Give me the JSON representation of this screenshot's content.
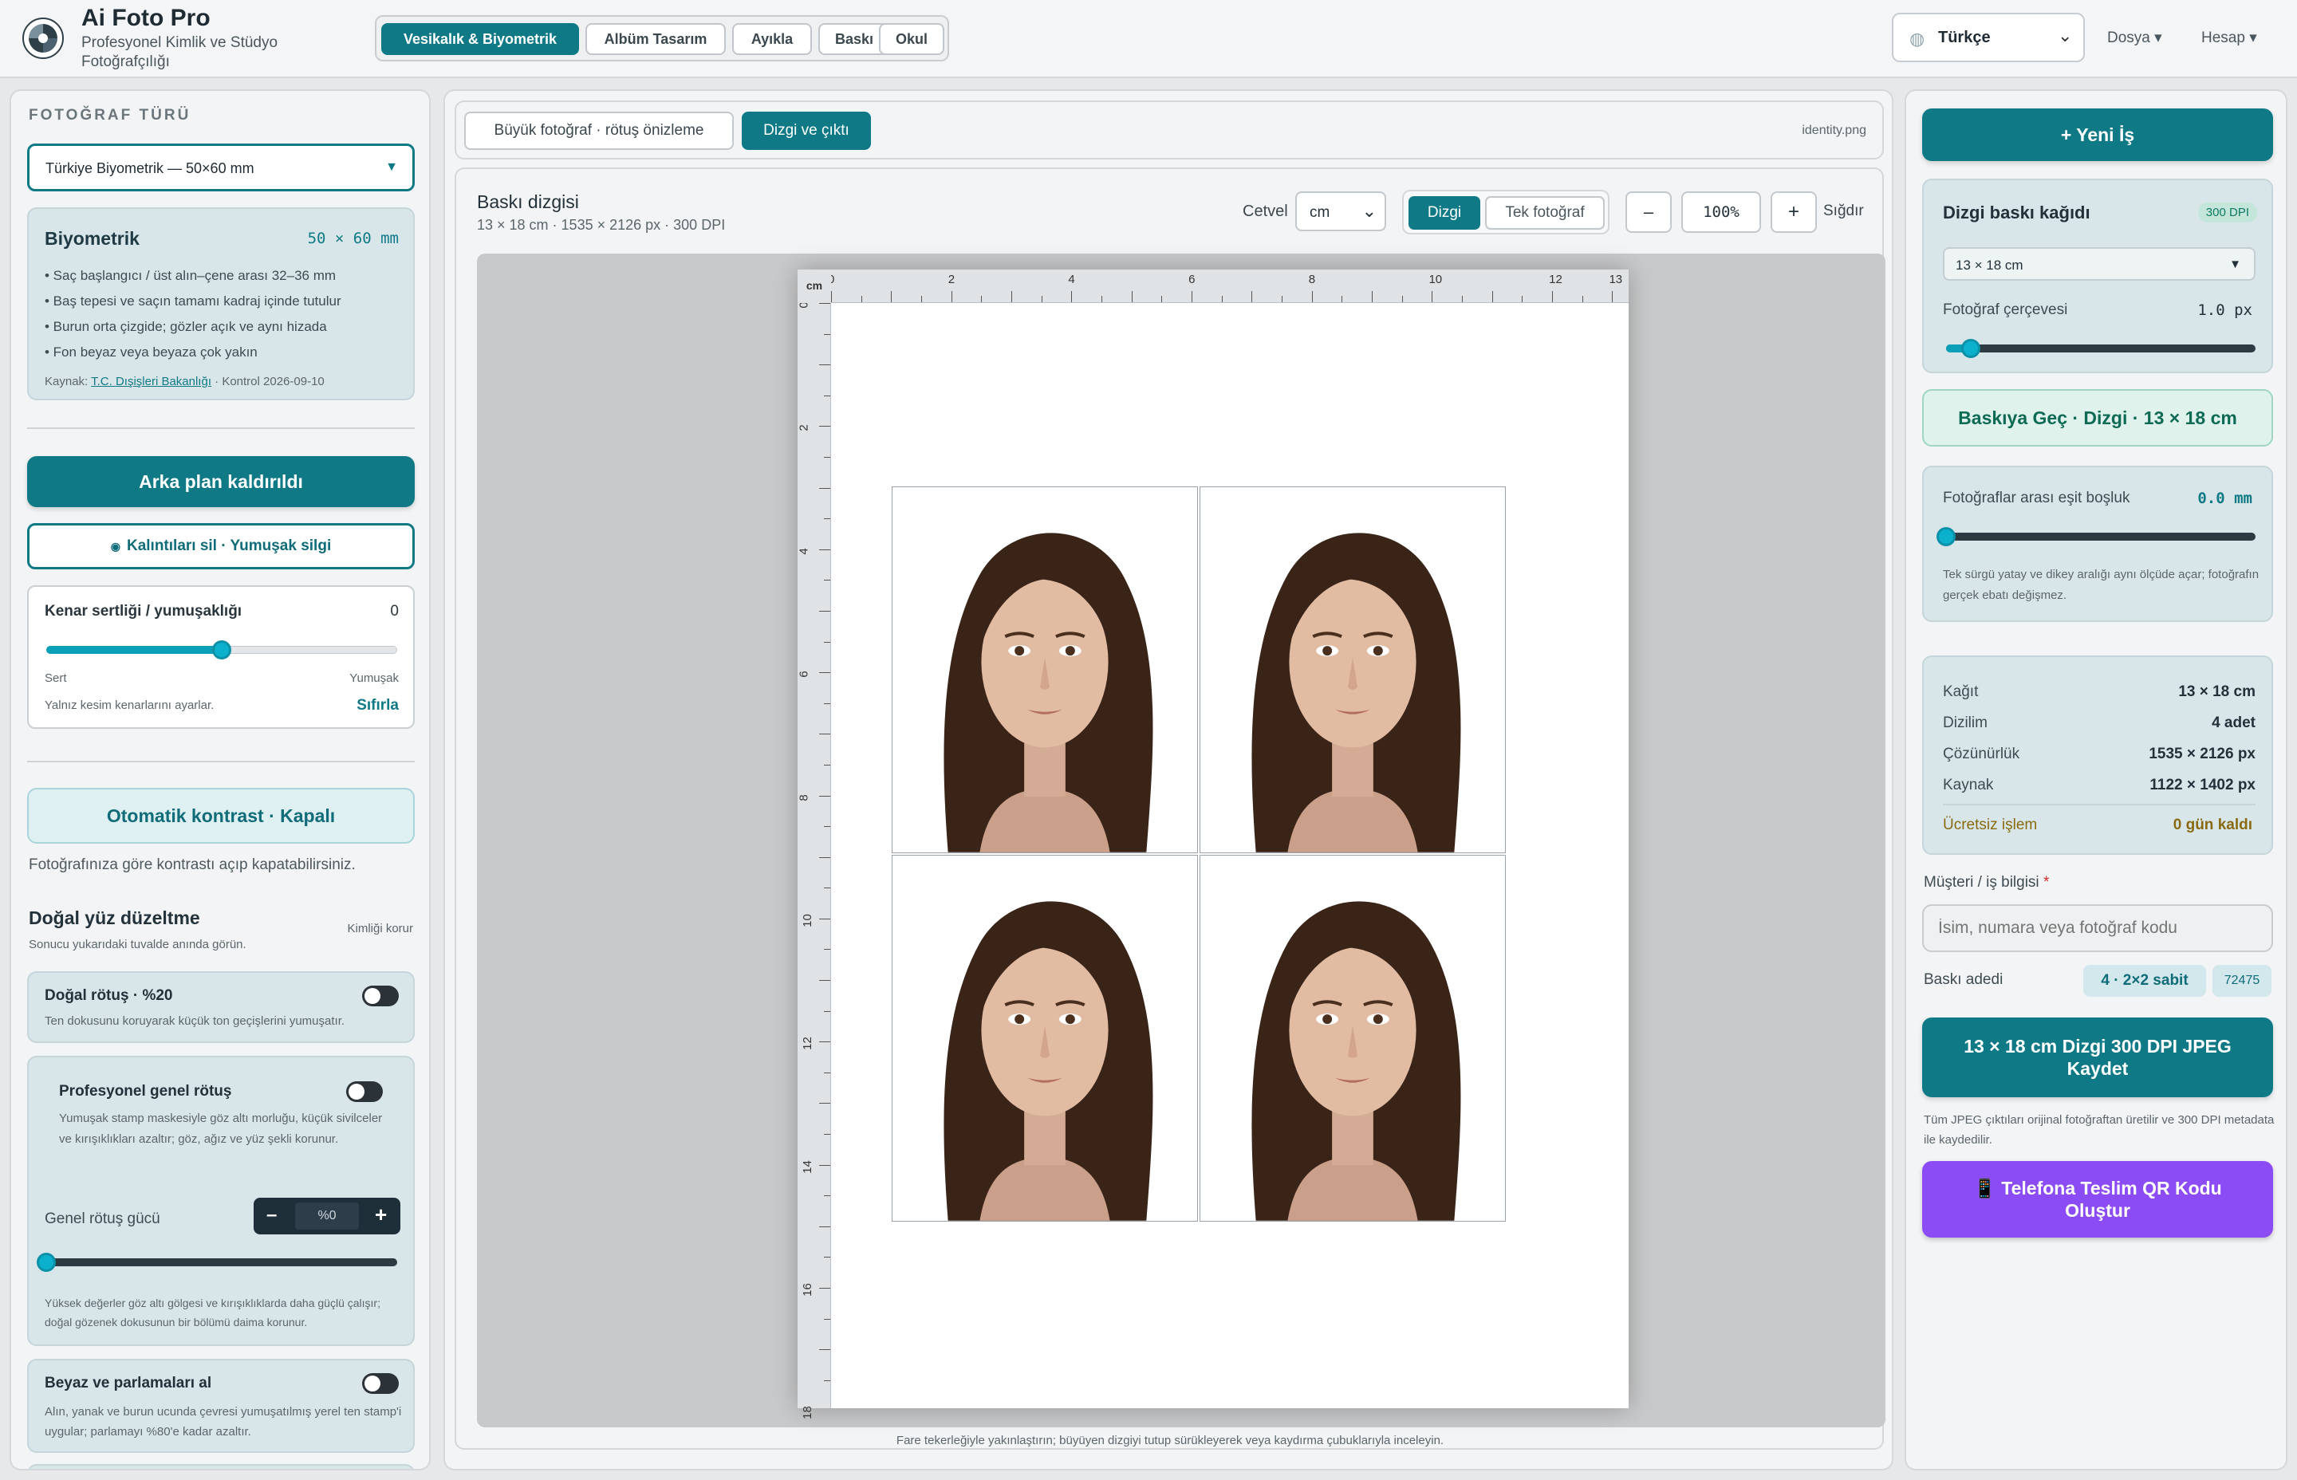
{
  "app": {
    "title": "Ai Foto Pro",
    "subtitle": "Profesyonel Kimlik ve Stüdyo Fotoğrafçılığı"
  },
  "nav": {
    "tabs": [
      {
        "label": "Vesikalık & Biyometrik"
      },
      {
        "label": "Albüm Tasarım"
      },
      {
        "label": "Ayıkla"
      },
      {
        "label": "Baskı"
      },
      {
        "label": "Okul"
      }
    ]
  },
  "header": {
    "language": "Türkçe",
    "menu_file": "Dosya ▾",
    "menu_account": "Hesap ▾"
  },
  "left": {
    "section_title": "FOTOĞRAF TÜRÜ",
    "photo_type": "Türkiye Biyometrik — 50×60 mm",
    "bio": {
      "title": "Biyometrik",
      "size": "50 × 60 mm",
      "rules": [
        "• Saç başlangıcı / üst alın–çene arası 32–36 mm",
        "• Baş tepesi ve saçın tamamı kadraj içinde tutulur",
        "• Burun orta çizgide; gözler açık ve aynı hizada",
        "• Fon beyaz veya beyaza çok yakın"
      ],
      "source_prefix": "Kaynak: ",
      "source_link": "T.C. Dışişleri Bakanlığı",
      "source_suffix": " · Kontrol 2026-09-10"
    },
    "bg_removed": "Arka plan kaldırıldı",
    "residue": "Kalıntıları sil · Yumuşak silgi",
    "edge": {
      "label": "Kenar sertliği / yumuşaklığı",
      "value": "0",
      "min_label": "Sert",
      "max_label": "Yumuşak",
      "note": "Yalnız kesim kenarlarını ayarlar.",
      "reset": "Sıfırla",
      "level": 0.5
    },
    "auto_contrast": "Otomatik kontrast · Kapalı",
    "auto_contrast_note": "Fotoğrafınıza göre kontrastı açıp kapatabilirsiniz.",
    "face": {
      "title": "Doğal yüz düzeltme",
      "note": "Sonucu yukarıdaki tuvalde anında görün.",
      "keep": "Kimliği korur"
    },
    "natural": {
      "title": "Doğal rötuş · %20",
      "desc": "Ten dokusunu koruyarak küçük ton geçişlerini yumuşatır."
    },
    "pro": {
      "title": "Profesyonel genel rötuş",
      "desc": "Yumuşak stamp maskesiyle göz altı morluğu, küçük sivilceler ve kırışıklıkları azaltır; göz, ağız ve yüz şekli korunur.",
      "power_label": "Genel rötuş gücü",
      "power_value": "%0",
      "minus": "–",
      "plus": "+",
      "note": "Yüksek değerler göz altı gölgesi ve kırışıklıklarda daha güçlü çalışır; doğal gözenek dokusunun bir bölümü daima korunur.",
      "level": 0
    },
    "white": {
      "title": "Beyaz ve parlamaları al",
      "desc": "Alın, yanak ve burun ucunda çevresi yumuşatılmış yerel ten stamp'i uygular; parlamayı %80'e kadar azaltır."
    }
  },
  "center": {
    "tab_preview": "Büyük fotoğraf · rötuş önizleme",
    "tab_layout": "Dizgi ve çıktı",
    "filename": "identity.png",
    "title": "Baskı dizgisi",
    "meta": "13 × 18 cm · 1535 × 2126 px · 300 DPI",
    "ruler_label": "Cetvel",
    "unit": "cm",
    "btn_layout": "Dizgi",
    "btn_single": "Tek fotoğraf",
    "zoom_minus": "–",
    "zoom": "100%",
    "zoom_plus": "+",
    "fit": "Sığdır",
    "ruler_corner": "cm",
    "h_ticks": [
      "0",
      "2",
      "4",
      "6",
      "8",
      "10",
      "12",
      "13"
    ],
    "v_ticks": [
      "0",
      "2",
      "4",
      "6",
      "8",
      "10",
      "12",
      "14",
      "16",
      "18"
    ],
    "footer": "Fare tekerleğiyle yakınlaştırın; büyüyen dizgiyi tutup sürükleyerek veya kaydırma çubuklarıyla inceleyin."
  },
  "right": {
    "new_job": "+ Yeni İş",
    "paper": {
      "title": "Dizgi baskı kağıdı",
      "dpi": "300 DPI",
      "size": "13 × 18 cm",
      "frame_label": "Fotoğraf çerçevesi",
      "frame_value": "1.0 px",
      "frame_level": 0.08
    },
    "go_print": "Baskıya Geç · Dizgi · 13 × 18 cm",
    "gap": {
      "label": "Fotoğraflar arası eşit boşluk",
      "value": "0.0 mm",
      "note": "Tek sürgü yatay ve dikey aralığı aynı ölçüde açar; fotoğrafın gerçek ebatı değişmez.",
      "level": 0
    },
    "stats": [
      {
        "k": "Kağıt",
        "v": "13 × 18 cm"
      },
      {
        "k": "Dizilim",
        "v": "4 adet"
      },
      {
        "k": "Çözünürlük",
        "v": "1535 × 2126 px"
      },
      {
        "k": "Kaynak",
        "v": "1122 × 1402 px"
      }
    ],
    "free": {
      "k": "Ücretsiz işlem",
      "v": "0 gün kaldı"
    },
    "customer_label": "Müşteri / iş bilgisi",
    "required": "*",
    "customer_placeholder": "İsim, numara veya fotoğraf kodu",
    "count_label": "Baskı adedi",
    "count_value": "4 · 2×2 sabit",
    "count_code": "72475",
    "save": "13 × 18 cm Dizgi 300 DPI JPEG Kaydet",
    "save_note": "Tüm JPEG çıktıları orijinal fotoğraftan üretilir ve 300 DPI metadata ile kaydedilir.",
    "qr": "📱 Telefona Teslim QR Kodu Oluştur"
  },
  "colors": {
    "accent": "#0f7a86",
    "purple": "#8b4cf5",
    "slider": "#0ab0cc"
  }
}
